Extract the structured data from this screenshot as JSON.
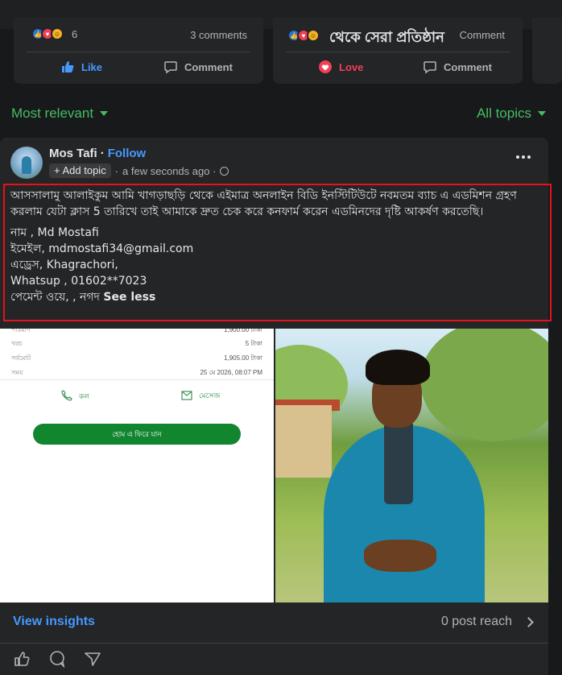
{
  "prev_posts": [
    {
      "reaction_count": "6",
      "comments": "3 comments",
      "actions": {
        "primary": "Like",
        "secondary": "Comment"
      }
    },
    {
      "title": "থেকে সেরা প্রতিষ্ঠান",
      "overlay_text": "Comment",
      "actions": {
        "primary": "Love",
        "secondary": "Comment"
      }
    }
  ],
  "filters": {
    "left": "Most relevant",
    "right": "All topics"
  },
  "post": {
    "author": "Mos Tafi",
    "separator": "·",
    "follow": "Follow",
    "add_topic": "+ Add topic",
    "time": "a few seconds ago ·",
    "body": {
      "intro": "আসসালামু আলাইকুম আমি খাগড়াছড়ি থেকে এইমাত্র অনলাইন বিডি ইনস্টিটিউটে নবমতম ব্যাচ এ এডমিশন গ্রহণ করলাম যেটা ক্লাস 5 তারিখে তাই আমাকে দ্রুত চেক করে কনফার্ম করেন এডমিনদের দৃষ্টি আকর্ষণ করতেছি।",
      "name": "নাম , Md Mostafi",
      "email": "ইমেইল, mdmostafi34@gmail.com",
      "address": "এড্রেস, Khagrachori,",
      "whatsapp": "Whatsup , 01602**7023",
      "payment": "পেমেন্ট ওয়ে, ,   নগদ",
      "see_less": "See less"
    },
    "receipt": {
      "rows": [
        {
          "k": "পরিমাণ",
          "v": "1,900.00 টাকা"
        },
        {
          "k": "খরচ",
          "v": "5 টাকা"
        },
        {
          "k": "সর্বমোট",
          "v": "1,905.00 টাকা"
        },
        {
          "k": "সময়",
          "v": "25 মে 2026, 08:07 PM"
        }
      ],
      "call": "কল",
      "message": "মেসেজ",
      "home_button": "হোম এ ফিরে যান"
    },
    "insights": "View insights",
    "reach": "0 post reach"
  },
  "colors": {
    "background": "#18191a",
    "card": "#242526",
    "accent_green": "#45bd62",
    "link_blue": "#4599ff",
    "highlight_red": "#e3141b",
    "love_red": "#f33e58"
  }
}
